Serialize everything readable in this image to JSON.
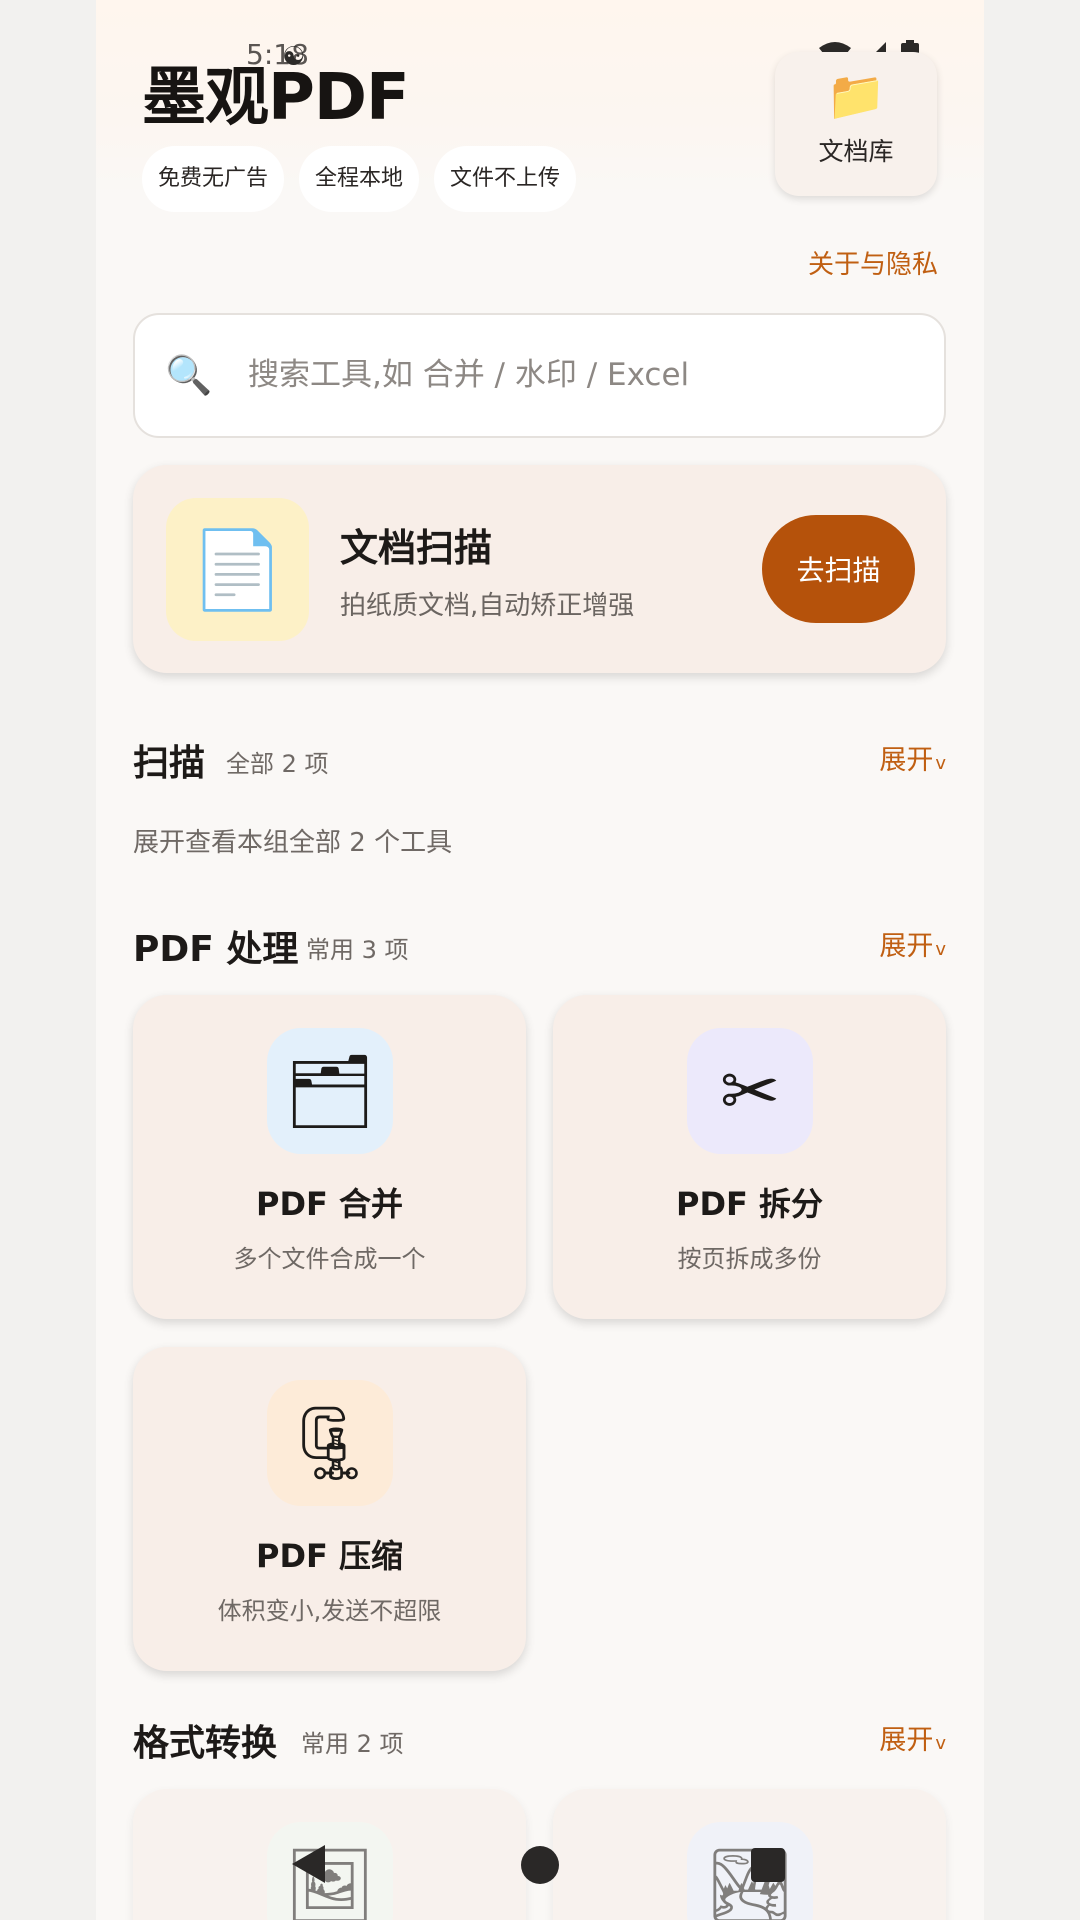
{
  "status": {
    "time": "5:18",
    "icons": [
      "android-debug-icon",
      "wifi-icon",
      "signal-icon",
      "battery-icon"
    ]
  },
  "header": {
    "title": "墨观PDF",
    "chips": [
      "免费无广告",
      "全程本地",
      "文件不上传"
    ],
    "library": {
      "icon": "folder-icon",
      "label": "文档库"
    },
    "about_link": "关于与隐私"
  },
  "search": {
    "icon": "search-icon",
    "placeholder": "搜索工具,如 合并 / 水印 / Excel",
    "value": ""
  },
  "scan_card": {
    "icon": "document-icon",
    "title": "文档扫描",
    "subtitle": "拍纸质文档,自动矫正增强",
    "button": "去扫描"
  },
  "sections": [
    {
      "name": "扫描",
      "count": "全部 2 项",
      "expand": "展开",
      "hint": "展开查看本组全部 2 个工具"
    },
    {
      "name": "PDF 处理",
      "count": "常用 3 项",
      "expand": "展开",
      "tools": [
        {
          "icon": "card-index-dividers-icon",
          "title": "PDF 合并",
          "subtitle": "多个文件合成一个",
          "icon_bg": "#e3f0fb"
        },
        {
          "icon": "scissors-icon",
          "title": "PDF 拆分",
          "subtitle": "按页拆成多份",
          "icon_bg": "#ece9fb"
        },
        {
          "icon": "clamp-icon",
          "title": "PDF 压缩",
          "subtitle": "体积变小,发送不超限",
          "icon_bg": "#fdebd8"
        }
      ]
    },
    {
      "name": "格式转换",
      "count": "常用 2 项",
      "expand": "展开",
      "tools": [
        {
          "icon": "framed-picture-icon",
          "icon_bg": "#eef6ee"
        },
        {
          "icon": "landscape-picture-icon",
          "icon_bg": "#e9eefa"
        }
      ]
    }
  ],
  "navbar": {
    "back": "back-icon",
    "home": "home-icon",
    "recents": "recents-icon"
  },
  "colors": {
    "accent": "#b5520b",
    "link": "#c05f12",
    "card": "#f8eee8"
  }
}
